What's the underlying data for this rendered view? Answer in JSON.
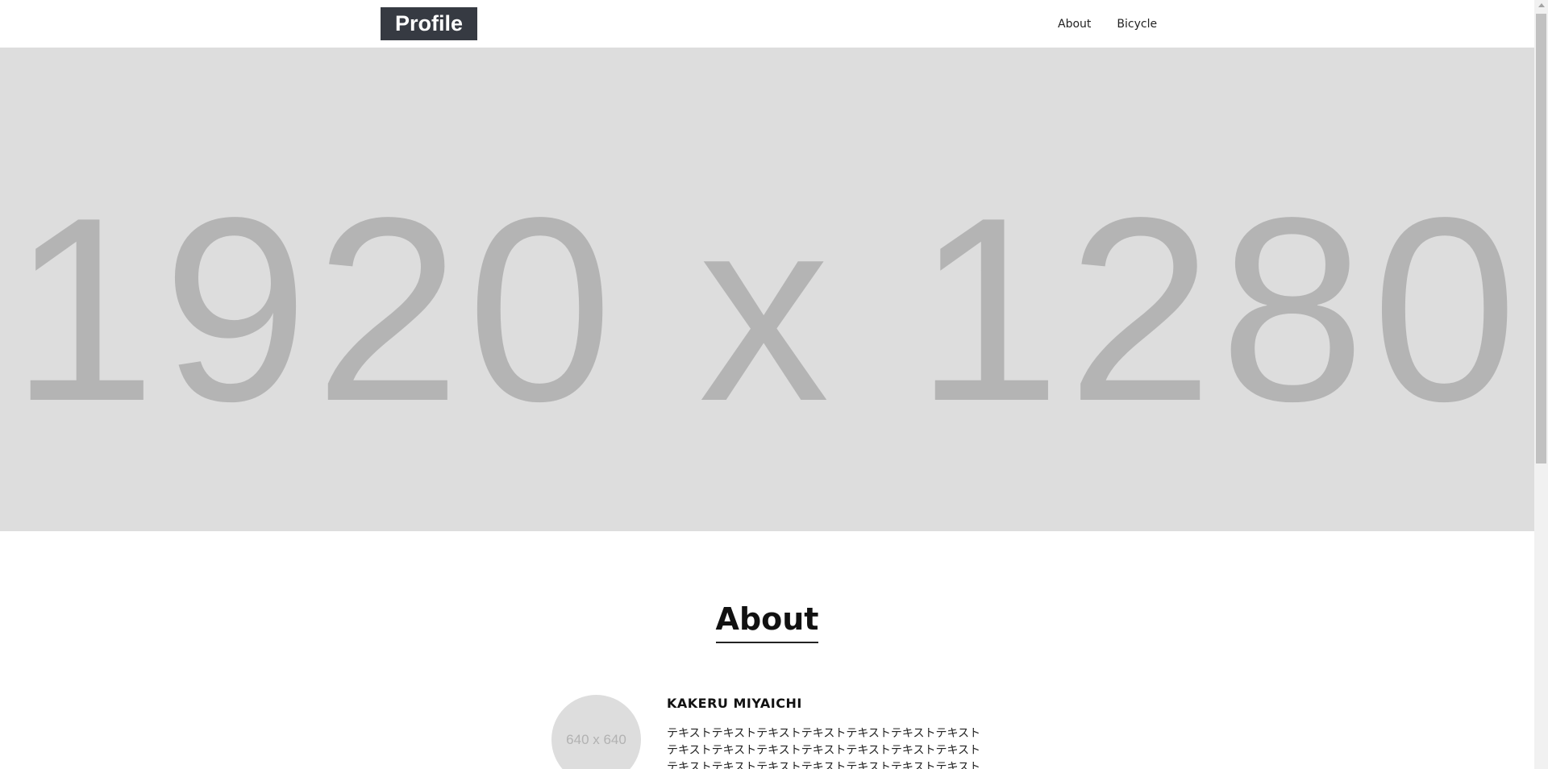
{
  "header": {
    "logo": "Profile",
    "nav": [
      {
        "label": "About"
      },
      {
        "label": "Bicycle"
      }
    ]
  },
  "hero": {
    "placeholder_text": "1920 x 1280"
  },
  "about": {
    "title": "About",
    "avatar_placeholder": "640 x 640",
    "name": "KAKERU MIYAICHI",
    "description": "テキストテキストテキストテキストテキストテキストテキストテキストテキストテキストテキストテキストテキストテキストテキストテキストテキストテキストテキストテキストテキスト"
  },
  "colors": {
    "logo_bg": "#363a42",
    "placeholder_bg": "#dddddd",
    "placeholder_text": "#b4b4b4"
  }
}
